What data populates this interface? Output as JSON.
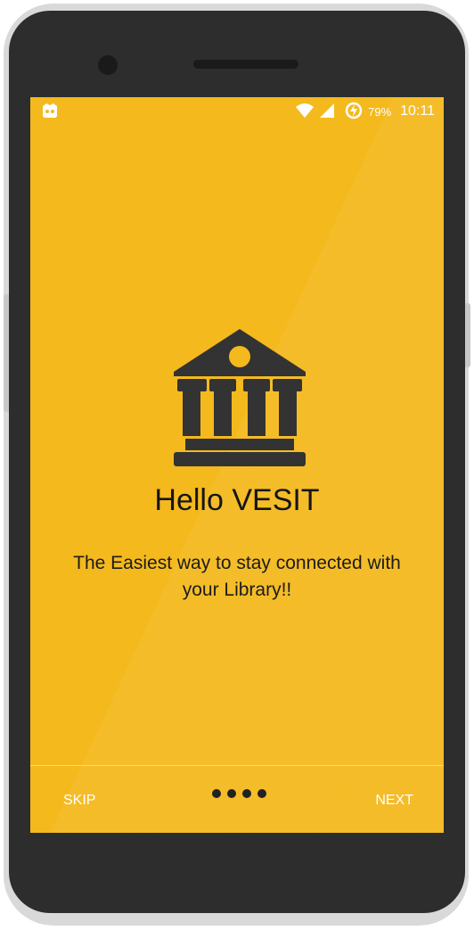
{
  "status_bar": {
    "battery_percent": "79%",
    "time": "10:11",
    "icons": [
      "app-notification-icon",
      "wifi-icon",
      "cell-signal-icon",
      "battery-charging-icon"
    ]
  },
  "onboarding": {
    "icon": "library-building-icon",
    "title": "Hello VESIT",
    "subtitle": "The Easiest way to stay connected with your Library!!",
    "page_indicator": {
      "total": 4,
      "current": 1
    }
  },
  "footer": {
    "skip_label": "SKIP",
    "next_label": "NEXT"
  },
  "colors": {
    "screen_background": "#f4b91d",
    "icon_color": "#333333",
    "button_text": "#ffffff"
  }
}
